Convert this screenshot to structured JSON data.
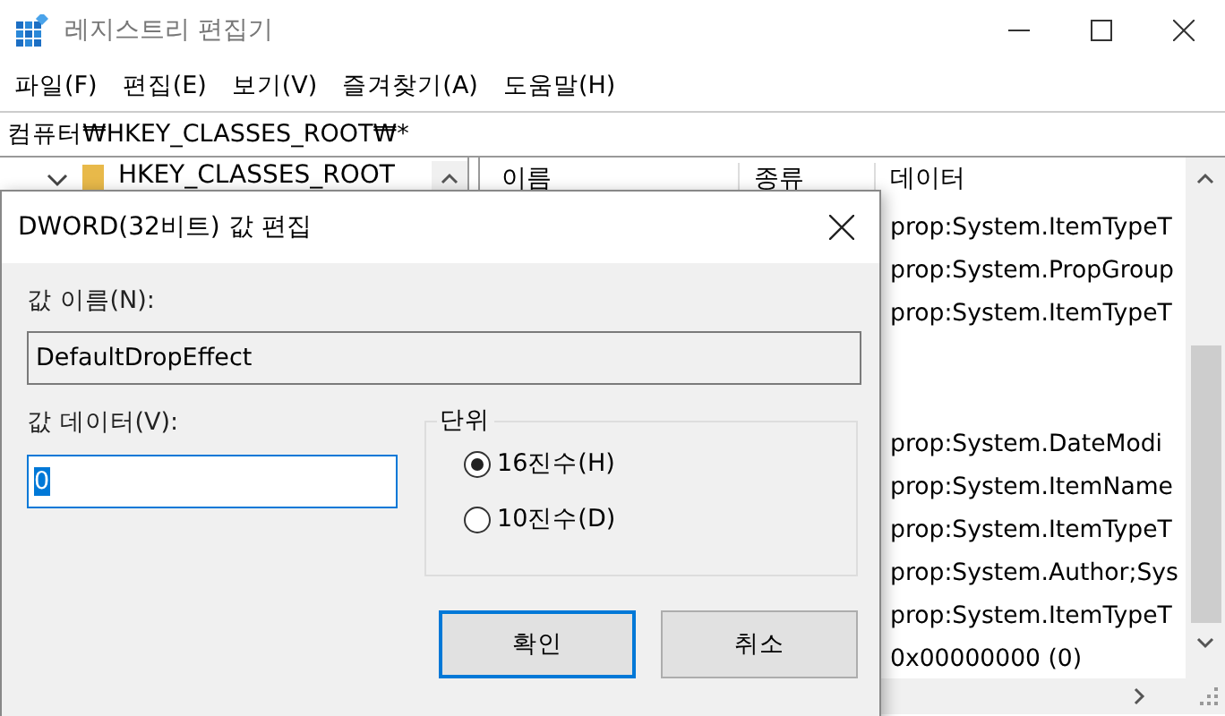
{
  "window": {
    "title": "레지스트리 편집기"
  },
  "menu": [
    "파일(F)",
    "편집(E)",
    "보기(V)",
    "즐겨찾기(A)",
    "도움말(H)"
  ],
  "address": "컴퓨터₩HKEY_CLASSES_ROOT₩*",
  "tree": {
    "items": [
      {
        "label": "HKEY_CLASSES_ROOT",
        "expanded": true
      }
    ]
  },
  "list": {
    "columns": [
      "이름",
      "종류",
      "데이터"
    ],
    "rows": [
      {
        "data": "prop:System.ItemTypeT"
      },
      {
        "data": "prop:System.PropGroup"
      },
      {
        "data": "prop:System.ItemTypeT"
      },
      {},
      {},
      {
        "data": "prop:System.DateModi"
      },
      {
        "data": "prop:System.ItemName"
      },
      {
        "data": "prop:System.ItemTypeT"
      },
      {
        "data": "prop:System.Author;Sys"
      },
      {
        "data": "prop:System.ItemTypeT"
      },
      {
        "data": "0x00000000 (0)"
      }
    ]
  },
  "dialog": {
    "title": "DWORD(32비트) 값 편집",
    "name_label": "값 이름(N):",
    "name_value": "DefaultDropEffect",
    "data_label": "값 데이터(V):",
    "data_value": "0",
    "base": {
      "label": "단위",
      "options": [
        {
          "label": "16진수(H)",
          "selected": true
        },
        {
          "label": "10진수(D)",
          "selected": false
        }
      ]
    },
    "buttons": [
      {
        "label": "확인",
        "default": true
      },
      {
        "label": "취소",
        "default": false
      }
    ]
  }
}
